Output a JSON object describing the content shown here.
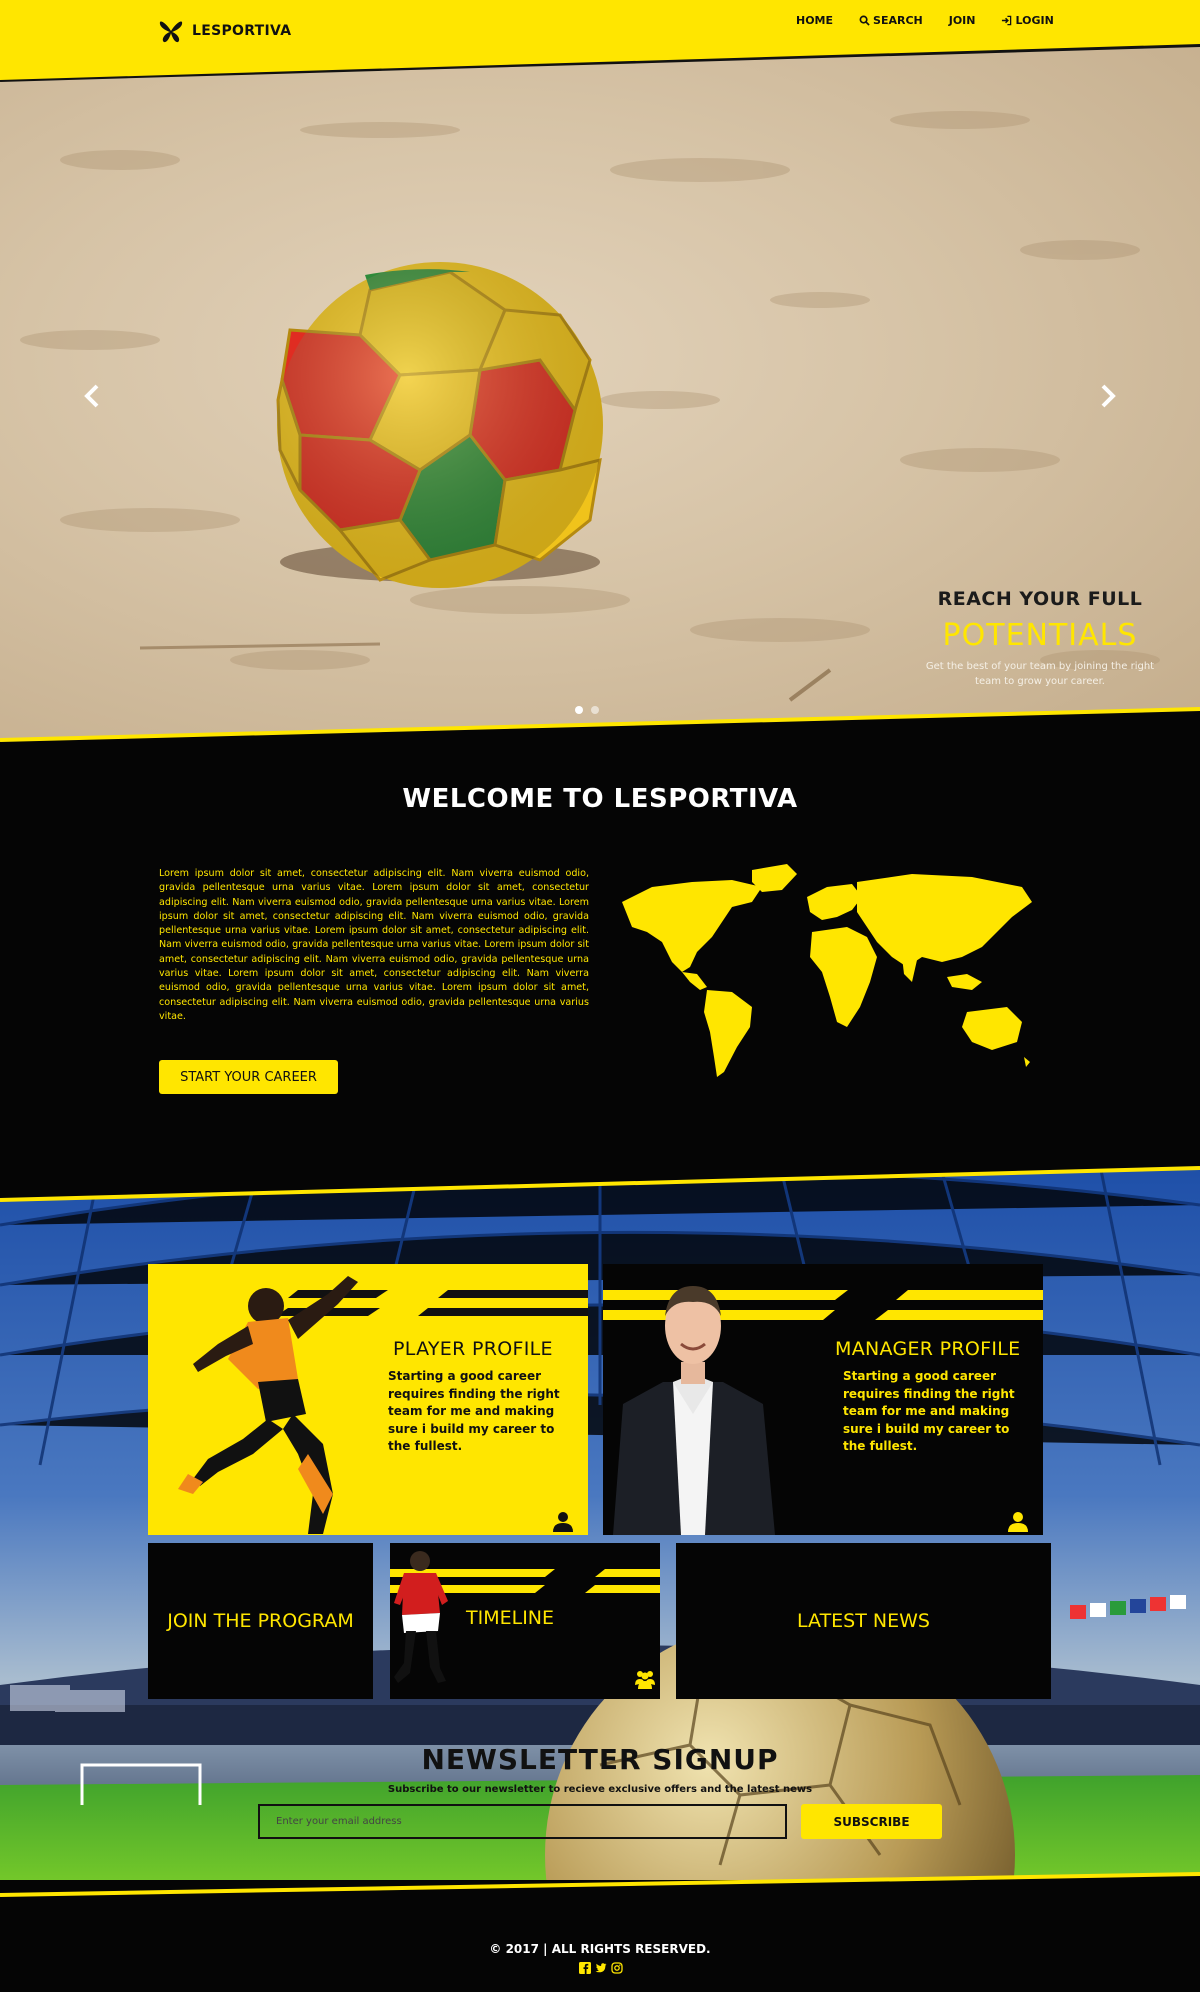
{
  "brand": {
    "name": "LESPORTIVA"
  },
  "nav": {
    "items": [
      {
        "label": "HOME"
      },
      {
        "label": "SEARCH",
        "icon": "search-icon"
      },
      {
        "label": "JOIN"
      },
      {
        "label": "LOGIN",
        "icon": "login-icon"
      }
    ]
  },
  "hero": {
    "caption_line1": "REACH YOUR FULL",
    "caption_line2": "POTENTIALS",
    "caption_line3": "Get the best of your team by joining the right team to grow your career.",
    "slides": 2,
    "active_slide": 1
  },
  "welcome": {
    "title": "WELCOME TO LESPORTIVA",
    "body": "Lorem ipsum dolor sit amet, consectetur adipiscing elit. Nam viverra euismod odio, gravida pellentesque urna varius vitae. Lorem ipsum dolor sit amet, consectetur adipiscing elit. Nam viverra euismod odio, gravida pellentesque urna varius vitae. Lorem ipsum dolor sit amet, consectetur adipiscing elit. Nam viverra euismod odio, gravida pellentesque urna varius vitae. Lorem ipsum dolor sit amet, consectetur adipiscing elit. Nam viverra euismod odio, gravida pellentesque urna varius vitae. Lorem ipsum dolor sit amet, consectetur adipiscing elit. Nam viverra euismod odio, gravida pellentesque urna varius vitae. Lorem ipsum dolor sit amet, consectetur adipiscing elit. Nam viverra euismod odio, gravida pellentesque urna varius vitae. Lorem ipsum dolor sit amet, consectetur adipiscing elit. Nam viverra euismod odio, gravida pellentesque urna varius vitae.",
    "cta": "START YOUR CAREER"
  },
  "tiles": {
    "player": {
      "title": "PLAYER PROFILE",
      "desc": "Starting a good career requires finding the right team for me and making sure i build my career to the fullest."
    },
    "manager": {
      "title": "MANAGER PROFILE",
      "desc": "Starting a good career requires finding the right team for me and making sure i build my career to the fullest."
    },
    "join": {
      "title": "JOIN THE PROGRAM"
    },
    "timeline": {
      "title": "TIMELINE"
    },
    "news": {
      "title": "LATEST NEWS"
    }
  },
  "newsletter": {
    "title": "NEWSLETTER SIGNUP",
    "subtitle": "Subscribe to our newsletter to recieve exclusive offers and the latest news",
    "placeholder": "Enter your email address",
    "button": "SUBSCRIBE"
  },
  "footer": {
    "copyright": "© 2017 | ALL RIGHTS RESERVED.",
    "socials": [
      "facebook-icon",
      "twitter-icon",
      "instagram-icon"
    ]
  },
  "colors": {
    "accent": "#ffe600",
    "dark": "#050505"
  }
}
